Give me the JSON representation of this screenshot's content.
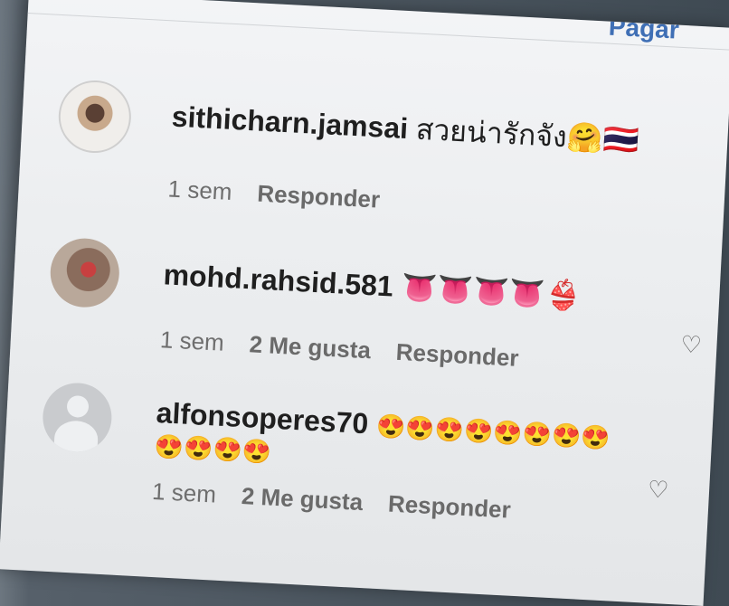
{
  "header": {
    "link_label": "Pagar"
  },
  "comments": [
    {
      "username": "sithicharn.jamsai",
      "text": "สวยน่ารักจัง🤗🇹🇭",
      "time": "1 sem",
      "likes": "",
      "reply_label": "Responder"
    },
    {
      "username": "mohd.rahsid.581",
      "text": "👅👅👅👅👙",
      "time": "1 sem",
      "likes": "2 Me gusta",
      "reply_label": "Responder"
    },
    {
      "username": "alfonsoperes70",
      "text": "😍😍😍😍😍😍😍😍",
      "text2": "😍😍😍😍",
      "time": "1 sem",
      "likes": "2 Me gusta",
      "reply_label": "Responder"
    }
  ],
  "icons": [
    "heart-icon",
    "default-avatar-icon"
  ]
}
